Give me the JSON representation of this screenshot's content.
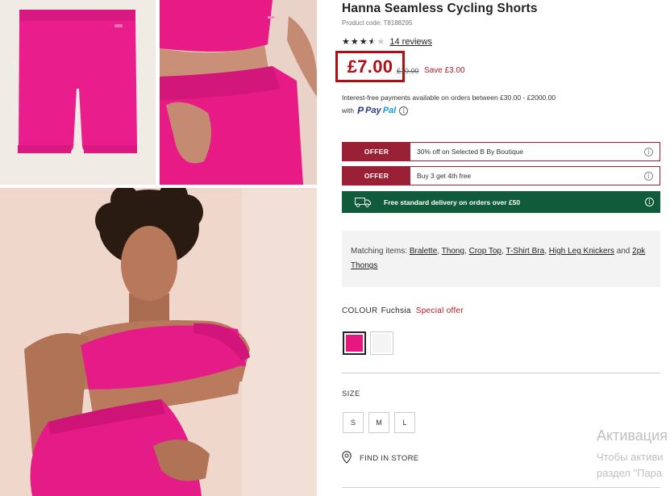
{
  "product": {
    "title": "Hanna Seamless Cycling Shorts",
    "code": "Product code: T8188295",
    "rating": 3.5,
    "rating_max": 5,
    "reviews_label": "14 reviews",
    "price": "£7.00",
    "was_price": "£10.00",
    "save_label": "Save £3.00"
  },
  "finance": {
    "line1": "Interest-free payments available on orders between £30.00 - £2000.00",
    "with_label": "with",
    "paypal_pay": "Pay",
    "paypal_pal": "Pal",
    "paypal_mark": "P"
  },
  "offers": [
    {
      "tag": "OFFER",
      "text": "30% off on Selected B By Boutique"
    },
    {
      "tag": "OFFER",
      "text": "Buy 3 get 4th free"
    }
  ],
  "delivery": {
    "text": "Free standard delivery on orders over £50"
  },
  "matching": {
    "label": "Matching items:",
    "items": [
      "Bralette",
      "Thong",
      "Crop Top",
      "T-Shirt Bra",
      "High Leg Knickers",
      "2pk Thongs"
    ],
    "and_label": "and"
  },
  "colour": {
    "label": "COLOUR",
    "selected": "Fuchsia",
    "special": "Special offer",
    "swatches": [
      "#e6177e",
      "#f4f4f4"
    ]
  },
  "size": {
    "label": "SIZE",
    "options": [
      "S",
      "M",
      "L"
    ]
  },
  "store": {
    "label": "FIND IN STORE"
  },
  "watermark": {
    "title": "Активация",
    "line1": "Чтобы активи",
    "line2": "раздел \"Пара"
  },
  "colors": {
    "accent_red": "#b00e14",
    "offer_maroon": "#9a2035",
    "delivery_green": "#0f5b3b",
    "product_pink": "#e6177e"
  },
  "icons": {
    "info": "info-icon",
    "truck": "delivery-truck-icon",
    "location": "location-pin-icon",
    "star": "star-icon"
  }
}
